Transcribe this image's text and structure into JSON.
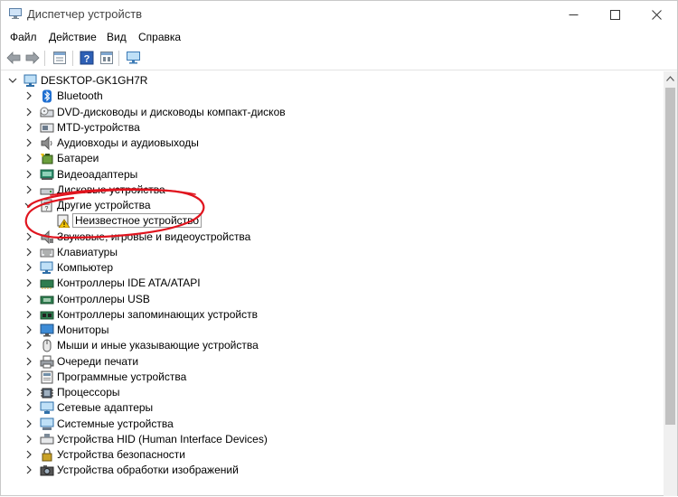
{
  "window": {
    "title": "Диспетчер устройств"
  },
  "menu": {
    "file": "Файл",
    "action": "Действие",
    "view": "Вид",
    "help": "Справка"
  },
  "toolbar": {
    "icons": [
      "back-arrow-icon",
      "forward-arrow-icon",
      "properties-icon",
      "help-icon",
      "update-driver-icon",
      "monitor-scan-icon"
    ]
  },
  "tree": {
    "root": "DESKTOP-GK1GH7R",
    "items": [
      {
        "label": "Bluetooth",
        "icon": "bluetooth-icon"
      },
      {
        "label": "DVD-дисководы и дисководы компакт-дисков",
        "icon": "dvd-drive-icon"
      },
      {
        "label": "MTD-устройства",
        "icon": "mtd-device-icon"
      },
      {
        "label": "Аудиовходы и аудиовыходы",
        "icon": "speaker-icon"
      },
      {
        "label": "Батареи",
        "icon": "battery-icon"
      },
      {
        "label": "Видеоадаптеры",
        "icon": "display-adapter-icon"
      },
      {
        "label": "Дисковые устройства",
        "icon": "disk-drive-icon"
      },
      {
        "label": "Другие устройства",
        "icon": "other-devices-icon",
        "expanded": true
      },
      {
        "label": "Неизвестное устройство",
        "icon": "warning-device-icon",
        "child": true
      },
      {
        "label": "Звуковые, игровые и видеоустройства",
        "icon": "sound-icon"
      },
      {
        "label": "Клавиатуры",
        "icon": "keyboard-icon"
      },
      {
        "label": "Компьютер",
        "icon": "computer-icon"
      },
      {
        "label": "Контроллеры IDE ATA/ATAPI",
        "icon": "ide-controller-icon"
      },
      {
        "label": "Контроллеры USB",
        "icon": "usb-controller-icon"
      },
      {
        "label": "Контроллеры запоминающих устройств",
        "icon": "storage-controller-icon"
      },
      {
        "label": "Мониторы",
        "icon": "monitor-icon"
      },
      {
        "label": "Мыши и иные указывающие устройства",
        "icon": "mouse-icon"
      },
      {
        "label": "Очереди печати",
        "icon": "printer-icon"
      },
      {
        "label": "Программные устройства",
        "icon": "software-device-icon"
      },
      {
        "label": "Процессоры",
        "icon": "processor-icon"
      },
      {
        "label": "Сетевые адаптеры",
        "icon": "network-adapter-icon"
      },
      {
        "label": "Системные устройства",
        "icon": "system-device-icon"
      },
      {
        "label": "Устройства HID (Human Interface Devices)",
        "icon": "hid-icon"
      },
      {
        "label": "Устройства безопасности",
        "icon": "security-device-icon"
      },
      {
        "label": "Устройства обработки изображений",
        "icon": "imaging-device-icon"
      }
    ]
  },
  "colors": {
    "annotation": "#e0141e",
    "accent": "#0a63b8",
    "warning": "#f2c200"
  }
}
